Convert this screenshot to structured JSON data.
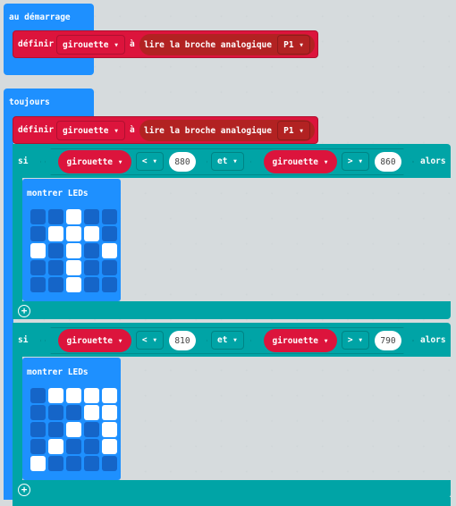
{
  "colors": {
    "events": "#1e90ff",
    "variables": "#dc143c",
    "pins": "#b22222",
    "logic": "#00a4a6",
    "basic": "#1e90ff",
    "workspace": "#ecf0f1"
  },
  "on_start": {
    "label": "au démarrage",
    "set": {
      "label": "définir",
      "variable": "girouette",
      "to": "à",
      "reader": "lire la broche analogique",
      "pin": "P1"
    }
  },
  "forever": {
    "label": "toujours",
    "set": {
      "label": "définir",
      "variable": "girouette",
      "to": "à",
      "reader": "lire la broche analogique",
      "pin": "P1"
    },
    "ifs": [
      {
        "if": "si",
        "then": "alors",
        "left": {
          "variable": "girouette",
          "op": "<",
          "value": "880"
        },
        "join": "et",
        "right": {
          "variable": "girouette",
          "op": ">",
          "value": "860"
        },
        "show": "montrer LEDs",
        "leds": [
          [
            0,
            0,
            1,
            0,
            0
          ],
          [
            0,
            1,
            1,
            1,
            0
          ],
          [
            1,
            0,
            1,
            0,
            1
          ],
          [
            0,
            0,
            1,
            0,
            0
          ],
          [
            0,
            0,
            1,
            0,
            0
          ]
        ]
      },
      {
        "if": "si",
        "then": "alors",
        "left": {
          "variable": "girouette",
          "op": "<",
          "value": "810"
        },
        "join": "et",
        "right": {
          "variable": "girouette",
          "op": ">",
          "value": "790"
        },
        "show": "montrer LEDs",
        "leds": [
          [
            0,
            1,
            1,
            1,
            1
          ],
          [
            0,
            0,
            0,
            1,
            1
          ],
          [
            0,
            0,
            1,
            0,
            1
          ],
          [
            0,
            1,
            0,
            0,
            1
          ],
          [
            1,
            0,
            0,
            0,
            0
          ]
        ]
      }
    ]
  }
}
